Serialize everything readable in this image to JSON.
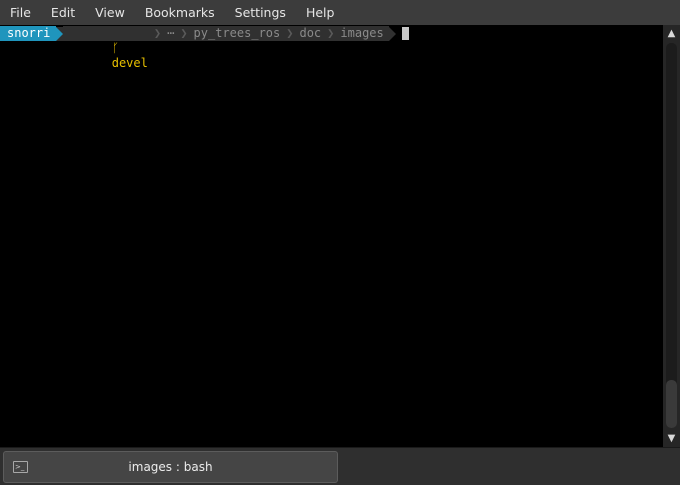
{
  "menu": {
    "items": [
      "File",
      "Edit",
      "View",
      "Bookmarks",
      "Settings",
      "Help"
    ]
  },
  "terminal": {
    "prompt": {
      "user": "snorri",
      "git_branch_icon": "branch-icon",
      "git_branch": "devel",
      "path_ellipsis": "⋯",
      "path": [
        "py_trees_ros",
        "doc",
        "images"
      ]
    }
  },
  "tab": {
    "label": "images : bash",
    "icon": "terminal-icon"
  },
  "colors": {
    "user_segment": "#1f95bd",
    "git_text": "#e8c000",
    "path_text": "#8a8a8a",
    "terminal_bg": "#000000"
  }
}
